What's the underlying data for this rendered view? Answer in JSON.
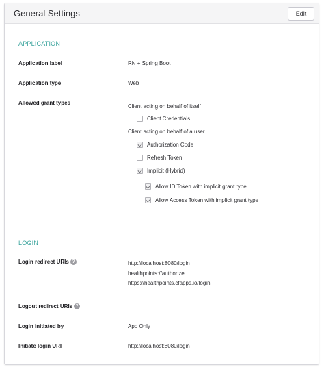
{
  "header": {
    "title": "General Settings",
    "edit_label": "Edit"
  },
  "application": {
    "section_title": "APPLICATION",
    "label_name": "Application label",
    "value_name": "RN + Spring Boot",
    "label_type": "Application type",
    "value_type": "Web",
    "label_grants": "Allowed grant types",
    "group_self": "Client acting on behalf of itself",
    "client_credentials": {
      "label": "Client Credentials",
      "checked": false
    },
    "group_user": "Client acting on behalf of a user",
    "authorization_code": {
      "label": "Authorization Code",
      "checked": true
    },
    "refresh_token": {
      "label": "Refresh Token",
      "checked": false
    },
    "implicit": {
      "label": "Implicit (Hybrid)",
      "checked": true
    },
    "allow_id_token": {
      "label": "Allow ID Token with implicit grant type",
      "checked": true
    },
    "allow_access_token": {
      "label": "Allow Access Token with implicit grant type",
      "checked": true
    }
  },
  "login": {
    "section_title": "LOGIN",
    "label_redirect": "Login redirect URIs",
    "redirect_uris": [
      "http://localhost:8080/login",
      "healthpoints://authorize",
      "https://healthpoints.cfapps.io/login"
    ],
    "label_logout": "Logout redirect URIs",
    "label_initiated": "Login initiated by",
    "value_initiated": "App Only",
    "label_initiate_uri": "Initiate login URI",
    "value_initiate_uri": "http://localhost:8080/login",
    "help_glyph": "?"
  }
}
